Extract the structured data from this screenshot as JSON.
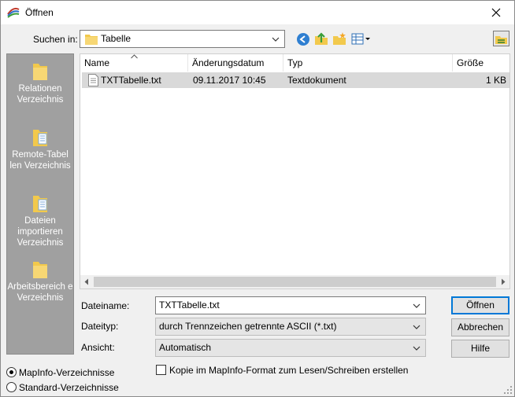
{
  "window": {
    "title": "Öffnen"
  },
  "lookin": {
    "label": "Suchen in:",
    "value": "Tabelle"
  },
  "places": [
    {
      "label": "Relationen Verzeichnis"
    },
    {
      "label": "Remote-Tabel len Verzeichnis"
    },
    {
      "label": "Dateien importieren Verzeichnis"
    },
    {
      "label": "Arbeitsbereich e Verzeichnis"
    }
  ],
  "filelist": {
    "columns": [
      "Name",
      "Änderungsdatum",
      "Typ",
      "Größe"
    ],
    "rows": [
      {
        "name": "TXTTabelle.txt",
        "date": "09.11.2017 10:45",
        "type": "Textdokument",
        "size": "1 KB"
      }
    ]
  },
  "form": {
    "filename_label": "Dateiname:",
    "filename_value": "TXTTabelle.txt",
    "filetype_label": "Dateityp:",
    "filetype_value": "durch Trennzeichen getrennte ASCII (*.txt)",
    "view_label": "Ansicht:",
    "view_value": "Automatisch",
    "copy_checkbox_label": "Kopie im MapInfo-Format zum Lesen/Schreiben erstellen"
  },
  "buttons": {
    "open": "Öffnen",
    "cancel": "Abbrechen",
    "help": "Hilfe"
  },
  "radios": {
    "mapinfo": "MapInfo-Verzeichnisse",
    "standard": "Standard-Verzeichnisse"
  },
  "colors": {
    "accent": "#0078d7",
    "places_bg": "#a0a0a0",
    "selection": "#d9d9d9"
  }
}
